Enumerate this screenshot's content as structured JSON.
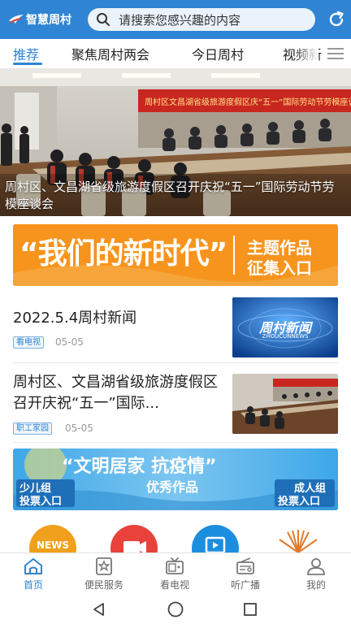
{
  "header": {
    "logo_text": "智慧周村",
    "search_placeholder": "请搜索您感兴趣的内容",
    "brand_color": "#2f84d4",
    "refresh_icon": "refresh-icon"
  },
  "tabs": [
    {
      "label": "推荐",
      "active": true
    },
    {
      "label": "聚焦周村两会",
      "active": false
    },
    {
      "label": "今日周村",
      "active": false
    },
    {
      "label": "视频新",
      "active": false
    }
  ],
  "hero": {
    "caption": "周村区、文昌湖省级旅游度假区召开庆祝“五一”国际劳动节劳模座谈会",
    "backdrop_text": "周村区文昌湖省级旅游度假区庆“五一”国际劳动节劳模座谈会"
  },
  "banner_new_era": {
    "text": "“我们的新时代”",
    "right_line1": "主题作品",
    "right_line2": "征集入口"
  },
  "news": [
    {
      "title": "2022.5.4周村新闻",
      "tag": "看电视",
      "date": "05-05",
      "thumb_title": "周村新闻",
      "thumb_sub": "ZHOUCUNNEWS"
    },
    {
      "title": "周村区、文昌湖省级旅游度假区召开庆祝“五一”国际...",
      "tag": "职工家园",
      "date": "05-05"
    }
  ],
  "banner_civilized": {
    "title": "“文明居家 抗疫情”",
    "subtitle": "优秀作品",
    "left_line1": "少儿组",
    "left_line2": "投票入口",
    "right_line1": "成人组",
    "right_line2": "投票入口"
  },
  "round_icons": [
    {
      "label": "NEWS"
    }
  ],
  "bottom_nav": [
    {
      "label": "首页",
      "icon": "home-icon",
      "active": true
    },
    {
      "label": "便民服务",
      "icon": "star-bookmark-icon",
      "active": false
    },
    {
      "label": "看电视",
      "icon": "tv-icon",
      "active": false
    },
    {
      "label": "听广播",
      "icon": "radio-icon",
      "active": false
    },
    {
      "label": "我的",
      "icon": "user-icon",
      "active": false
    }
  ],
  "system_nav": {
    "back": "back-icon",
    "home": "home-circle-icon",
    "recents": "recents-icon"
  }
}
